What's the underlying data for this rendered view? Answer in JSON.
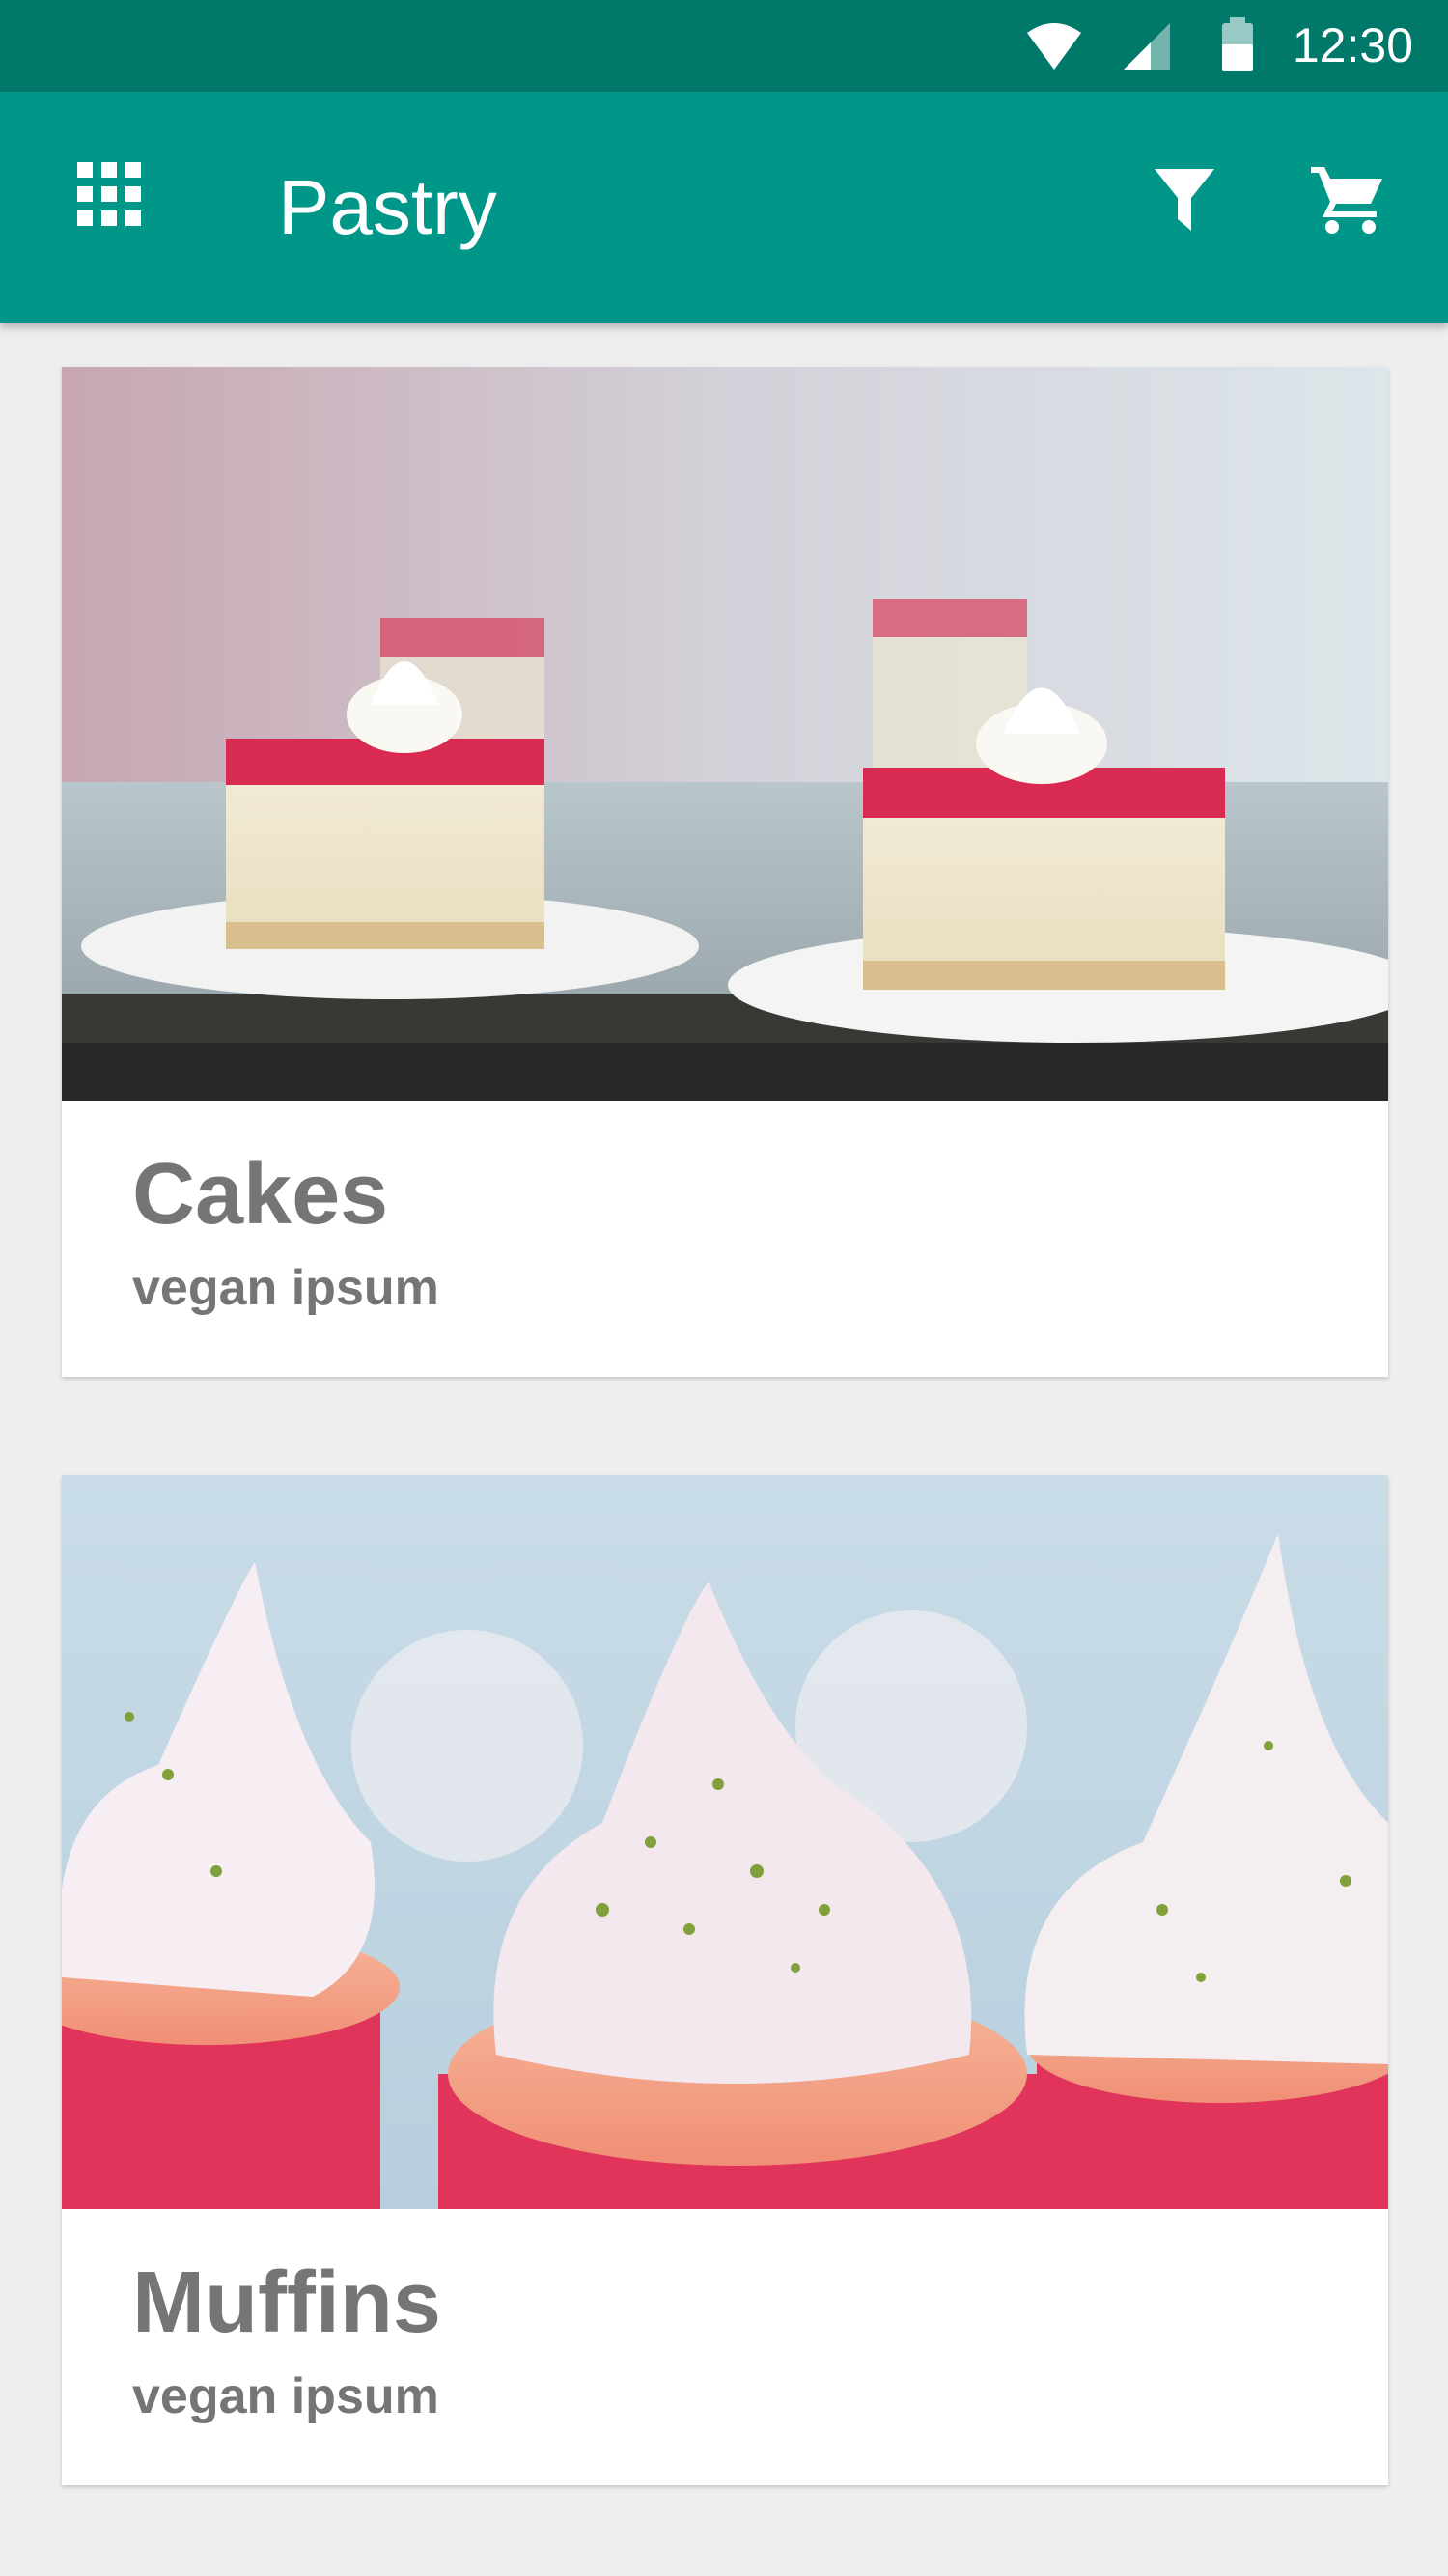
{
  "status_bar": {
    "time": "12:30",
    "icons": [
      "wifi-icon",
      "cellular-signal-icon",
      "battery-icon"
    ]
  },
  "app_bar": {
    "title": "Pastry",
    "left_icon": "grid-menu-icon",
    "right_icons": [
      "filter-icon",
      "shopping-cart-icon"
    ]
  },
  "cards": [
    {
      "title": "Cakes",
      "subtitle": "vegan ipsum",
      "image": "cheesecake-squares-photo"
    },
    {
      "title": "Muffins",
      "subtitle": "vegan ipsum",
      "image": "cupcakes-photo"
    }
  ],
  "colors": {
    "status_bar": "#00796B",
    "app_bar": "#009688",
    "background": "#EEEEEE",
    "card": "#FFFFFF",
    "card_text": "#757575"
  }
}
